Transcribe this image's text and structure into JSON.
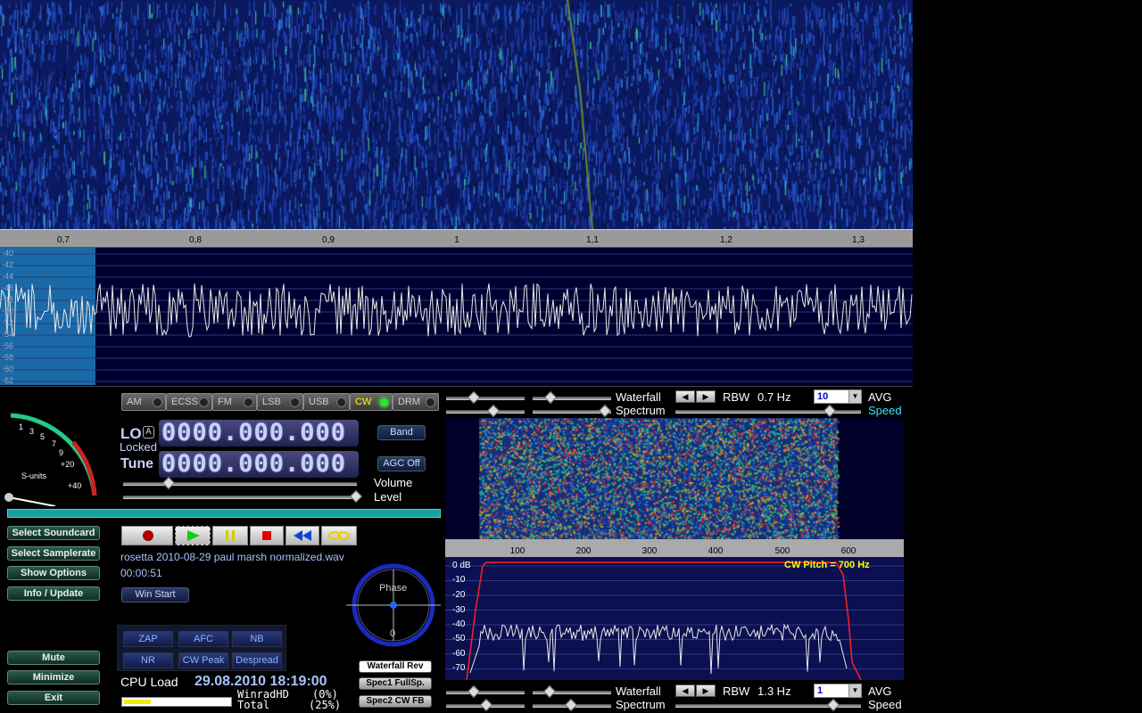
{
  "waterfall_axis": {
    "ticks": [
      "0,7",
      "0,8",
      "0,9",
      "1",
      "1,1",
      "1,2",
      "1,3"
    ]
  },
  "spectrum": {
    "db_labels": [
      "-40",
      "-42",
      "-44",
      "-46",
      "-48",
      "-50",
      "-52",
      "-54",
      "-56",
      "-58",
      "-60",
      "-62"
    ]
  },
  "smeter": {
    "label": "S-units",
    "scale": [
      "1",
      "3",
      "5",
      "7",
      "9",
      "+20",
      "+40"
    ]
  },
  "modes": [
    {
      "label": "AM",
      "active": false
    },
    {
      "label": "ECSS",
      "active": false
    },
    {
      "label": "FM",
      "active": false
    },
    {
      "label": "LSB",
      "active": false
    },
    {
      "label": "USB",
      "active": false
    },
    {
      "label": "CW",
      "active": true
    },
    {
      "label": "DRM",
      "active": false
    }
  ],
  "lo": {
    "label": "LO",
    "badge": "A",
    "status": "Locked",
    "freq": "0000.000.000"
  },
  "tune": {
    "label": "Tune",
    "freq": "0000.000.000"
  },
  "band_button": "Band",
  "agc_button": "AGC Off",
  "volume_label": "Volume",
  "level_label": "Level",
  "left_buttons": {
    "select_soundcard": "Select Soundcard",
    "select_samplerate": "Select Samplerate",
    "show_options": "Show Options",
    "info_update": "Info / Update",
    "mute": "Mute",
    "minimize": "Minimize",
    "exit": "Exit"
  },
  "file": {
    "name": "rosetta 2010-08-29 paul marsh normalized.wav",
    "time": "00:00:51"
  },
  "win_start": "Win Start",
  "phase": {
    "label": "Phase",
    "value": "0"
  },
  "dsp": {
    "zap": "ZAP",
    "afc": "AFC",
    "nb": "NB",
    "nr": "NR",
    "cw_peak": "CW Peak",
    "despread": "Despread"
  },
  "cpu": {
    "label": "CPU Load",
    "datetime": "29.08.2010 18:19:00",
    "winrad_label": "WinradHD",
    "winrad_pct": "(0%)",
    "total_label": "Total",
    "total_pct": "(25%)",
    "load": 0.25
  },
  "small_buttons": {
    "waterfall_rev": "Waterfall Rev",
    "spec1": "Spec1 FullSp.",
    "spec2": "Spec2 CW FB"
  },
  "top_controls": {
    "waterfall": "Waterfall",
    "spectrum": "Spectrum",
    "rbw_label": "RBW",
    "rbw_value": "0.7 Hz",
    "avg_value": "10",
    "avg_label": "AVG",
    "speed_label": "Speed"
  },
  "bottom_controls": {
    "waterfall": "Waterfall",
    "spectrum": "Spectrum",
    "rbw_label": "RBW",
    "rbw_value": "1.3 Hz",
    "avg_value": "1",
    "avg_label": "AVG",
    "speed_label": "Speed"
  },
  "audio_axis": {
    "ticks": [
      "100",
      "200",
      "300",
      "400",
      "500",
      "600"
    ]
  },
  "audio_spec": {
    "db_labels": [
      "0  dB",
      "-10",
      "-20",
      "-30",
      "-40",
      "-50",
      "-60",
      "-70"
    ],
    "cw_pitch": "CW Pitch = 700 Hz"
  },
  "colors": {
    "cw_pitch": "#ffff00",
    "filter_line": "#ff2020",
    "speed": "#40e0ff"
  }
}
